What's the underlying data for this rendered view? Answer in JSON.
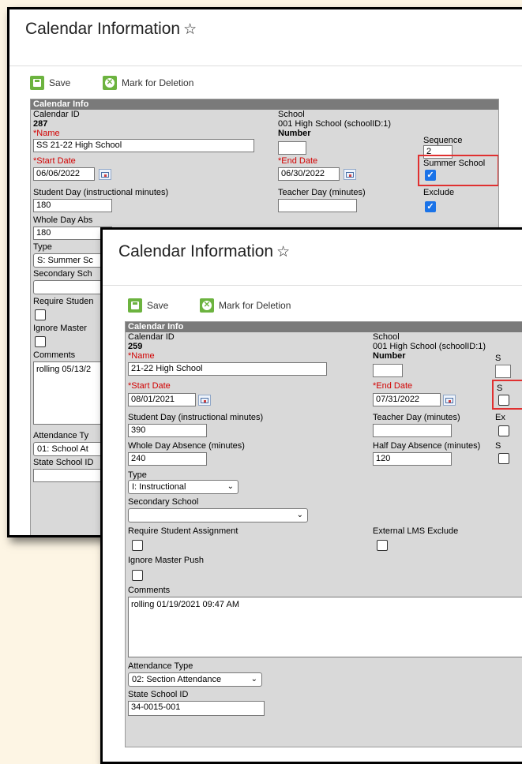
{
  "back": {
    "title": "Calendar Information",
    "toolbar": {
      "save": "Save",
      "delete": "Mark for Deletion"
    },
    "panel_title": "Calendar Info",
    "calendar_id_label": "Calendar ID",
    "calendar_id": "287",
    "school_label": "School",
    "school_value": "001 High School (schoolID:1)",
    "name_label": "*Name",
    "name": "SS 21-22  High School",
    "number_label": "Number",
    "number": "",
    "sequence_label": "Sequence",
    "sequence": "2",
    "start_label": "*Start Date",
    "start": "06/06/2022",
    "end_label": "*End Date",
    "end": "06/30/2022",
    "summer_label": "Summer School",
    "summer_checked": true,
    "student_day_label": "Student Day (instructional minutes)",
    "student_day": "180",
    "teacher_day_label": "Teacher Day (minutes)",
    "teacher_day": "",
    "exclude_label": "Exclude",
    "exclude_checked": true,
    "whole_day_label": "Whole Day Abs",
    "whole_day": "180",
    "type_label": "Type",
    "type": "S: Summer Sc",
    "secondary_label": "Secondary Sch",
    "require_label": "Require Studen",
    "ignore_label": "Ignore Master",
    "comments_label": "Comments",
    "comments": "rolling 05/13/2",
    "attendance_label": "Attendance Ty",
    "attendance": "01: School At",
    "state_label": "State School ID"
  },
  "front": {
    "title": "Calendar Information",
    "toolbar": {
      "save": "Save",
      "delete": "Mark for Deletion"
    },
    "panel_title": "Calendar Info",
    "calendar_id_label": "Calendar ID",
    "calendar_id": "259",
    "school_label": "School",
    "school_value": "001 High School (schoolID:1)",
    "name_label": "*Name",
    "name": "21-22  High School",
    "number_label": "Number",
    "number": "",
    "start_label": "*Start Date",
    "start": "08/01/2021",
    "end_label": "*End Date",
    "end": "07/31/2022",
    "student_day_label": "Student Day (instructional minutes)",
    "student_day": "390",
    "teacher_day_label": "Teacher Day (minutes)",
    "teacher_day": "",
    "whole_day_label": "Whole Day Absence (minutes)",
    "whole_day": "240",
    "half_day_label": "Half Day Absence (minutes)",
    "half_day": "120",
    "type_label": "Type",
    "type": "I: Instructional",
    "secondary_label": "Secondary School",
    "secondary": "",
    "require_label": "Require Student Assignment",
    "lms_label": "External LMS Exclude",
    "ignore_label": "Ignore Master Push",
    "comments_label": "Comments",
    "comments": "rolling 01/19/2021 09:47 AM",
    "attendance_label": "Attendance Type",
    "attendance": "02: Section Attendance",
    "state_label": "State School ID",
    "state": "34-0015-001",
    "cut_s1": "S",
    "cut_s2": "S",
    "cut_ex": "Ex",
    "cut_s3": "S"
  },
  "icons": {
    "star": "star-outline-icon",
    "save": "save-disk-icon",
    "delete": "delete-x-icon",
    "calendar": "calendar-icon",
    "check": "checkmark-icon",
    "chevron": "chevron-down-icon"
  }
}
